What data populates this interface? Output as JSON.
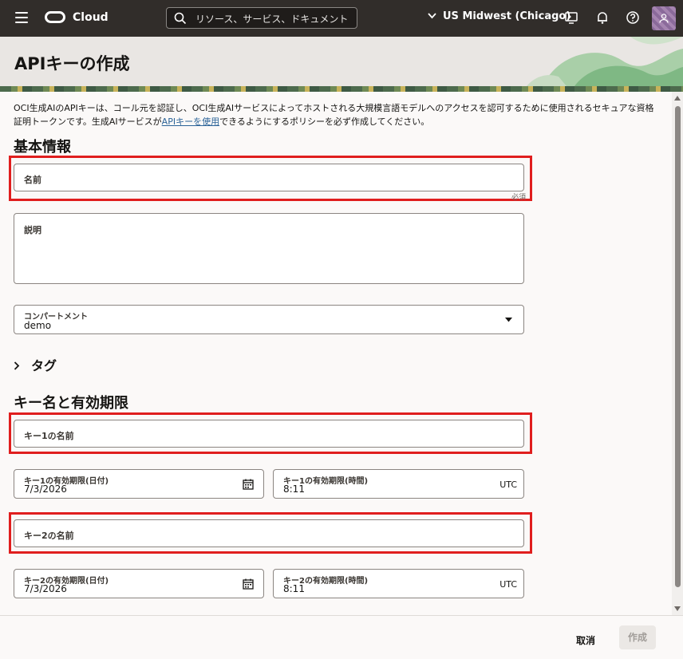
{
  "topbar": {
    "brand": "Cloud",
    "search_placeholder": "リソース、サービス、ドキュメント",
    "region": "US Midwest (Chicago)"
  },
  "page": {
    "title": "APIキーの作成",
    "intro_part1": "OCI生成AIのAPIキーは、コール元を認証し、OCI生成AIサービスによってホストされる大規模言語モデルへのアクセスを認可するために使用されるセキュアな資格証明トークンです。生成AIサービスが",
    "intro_link": "APIキーを使用",
    "intro_part2": "できるようにするポリシーを必ず作成してください。"
  },
  "basic": {
    "heading": "基本情報",
    "name_label": "名前",
    "required_hint": "必須",
    "description_label": "説明",
    "compartment_label": "コンパートメント",
    "compartment_value": "demo",
    "tags_label": "タグ"
  },
  "keys": {
    "heading": "キー名と有効期限",
    "key1_name_label": "キー1の名前",
    "key1_date_label": "キー1の有効期限(日付)",
    "key1_date_value": "7/3/2026",
    "key1_time_label": "キー1の有効期限(時間)",
    "key1_time_value": "8:11",
    "key2_name_label": "キー2の名前",
    "key2_date_label": "キー2の有効期限(日付)",
    "key2_date_value": "7/3/2026",
    "key2_time_label": "キー2の有効期限(時間)",
    "key2_time_value": "8:11",
    "timezone": "UTC"
  },
  "footer": {
    "cancel": "取消",
    "create": "作成"
  },
  "colors": {
    "topbar": "#312d2a",
    "highlight": "#e01e1e",
    "link": "#2b6398"
  }
}
